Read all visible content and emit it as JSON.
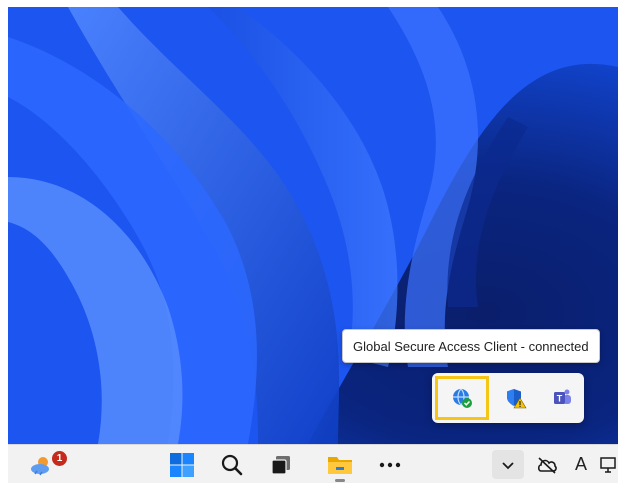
{
  "tooltip": {
    "text": "Global Secure Access Client - connected"
  },
  "tray": {
    "icons": [
      "global-secure-access-icon",
      "defender-warning-icon",
      "teams-icon"
    ]
  },
  "taskbar": {
    "weather_badge": "1",
    "ime_label": "A"
  },
  "colors": {
    "highlight": "#f5c518",
    "wallpaper_blue": "#1f60ff",
    "taskbar": "#f2f2f2"
  }
}
